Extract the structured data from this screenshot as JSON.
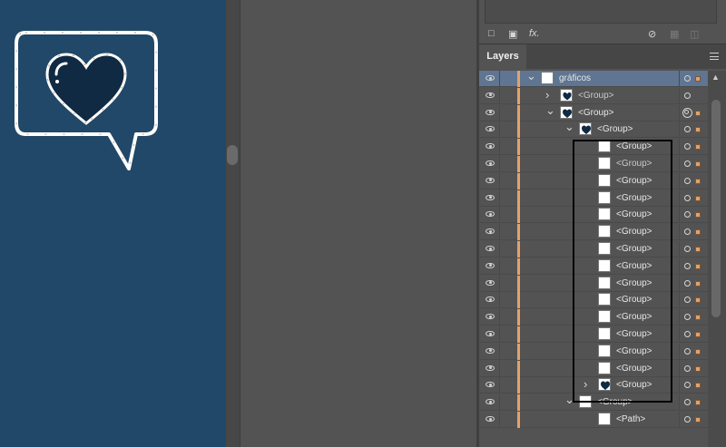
{
  "panel": {
    "title": "Layers",
    "top_icons": [
      "new-square-icon",
      "clip-mask-icon",
      "fx-icon",
      "no-icon",
      "new-layer-icon",
      "trash-icon"
    ],
    "fx_label": "fx."
  },
  "colors": {
    "canvas_bg": "#214868",
    "layer_color": "#e2a26b",
    "selected_row": "#5f7591"
  },
  "layers": [
    {
      "name": "gráficos",
      "depth": 0,
      "chevron": "v",
      "selected": true,
      "thumb": "blank",
      "target": "single"
    },
    {
      "name": "<Group>",
      "depth": 1,
      "chevron": ">",
      "thumb": "heart-bubble",
      "target": "single",
      "dim": true,
      "nosel": true
    },
    {
      "name": "<Group>",
      "depth": 1,
      "chevron": "v",
      "thumb": "heart",
      "target": "double"
    },
    {
      "name": "<Group>",
      "depth": 2,
      "chevron": "v",
      "thumb": "heart-big",
      "target": "single"
    },
    {
      "name": "<Group>",
      "depth": 3,
      "thumb": "blank",
      "target": "single"
    },
    {
      "name": "<Group>",
      "depth": 3,
      "thumb": "blank",
      "target": "single",
      "dim": true
    },
    {
      "name": "<Group>",
      "depth": 3,
      "thumb": "blank",
      "target": "single"
    },
    {
      "name": "<Group>",
      "depth": 3,
      "thumb": "blank",
      "target": "single"
    },
    {
      "name": "<Group>",
      "depth": 3,
      "thumb": "blank",
      "target": "single"
    },
    {
      "name": "<Group>",
      "depth": 3,
      "thumb": "blank",
      "target": "single"
    },
    {
      "name": "<Group>",
      "depth": 3,
      "thumb": "blank",
      "target": "single"
    },
    {
      "name": "<Group>",
      "depth": 3,
      "thumb": "blank",
      "target": "single"
    },
    {
      "name": "<Group>",
      "depth": 3,
      "thumb": "blank",
      "target": "single"
    },
    {
      "name": "<Group>",
      "depth": 3,
      "thumb": "blank",
      "target": "single"
    },
    {
      "name": "<Group>",
      "depth": 3,
      "thumb": "blank",
      "target": "single"
    },
    {
      "name": "<Group>",
      "depth": 3,
      "thumb": "blank",
      "target": "single"
    },
    {
      "name": "<Group>",
      "depth": 3,
      "thumb": "blank",
      "target": "single"
    },
    {
      "name": "<Group>",
      "depth": 3,
      "thumb": "blank",
      "target": "single"
    },
    {
      "name": "<Group>",
      "depth": 3,
      "chevron": ">",
      "thumb": "heart-big",
      "target": "single"
    },
    {
      "name": "<Group>",
      "depth": 2,
      "chevron": "v",
      "thumb": "blank",
      "target": "single"
    },
    {
      "name": "<Path>",
      "depth": 3,
      "thumb": "blank",
      "target": "single"
    }
  ]
}
